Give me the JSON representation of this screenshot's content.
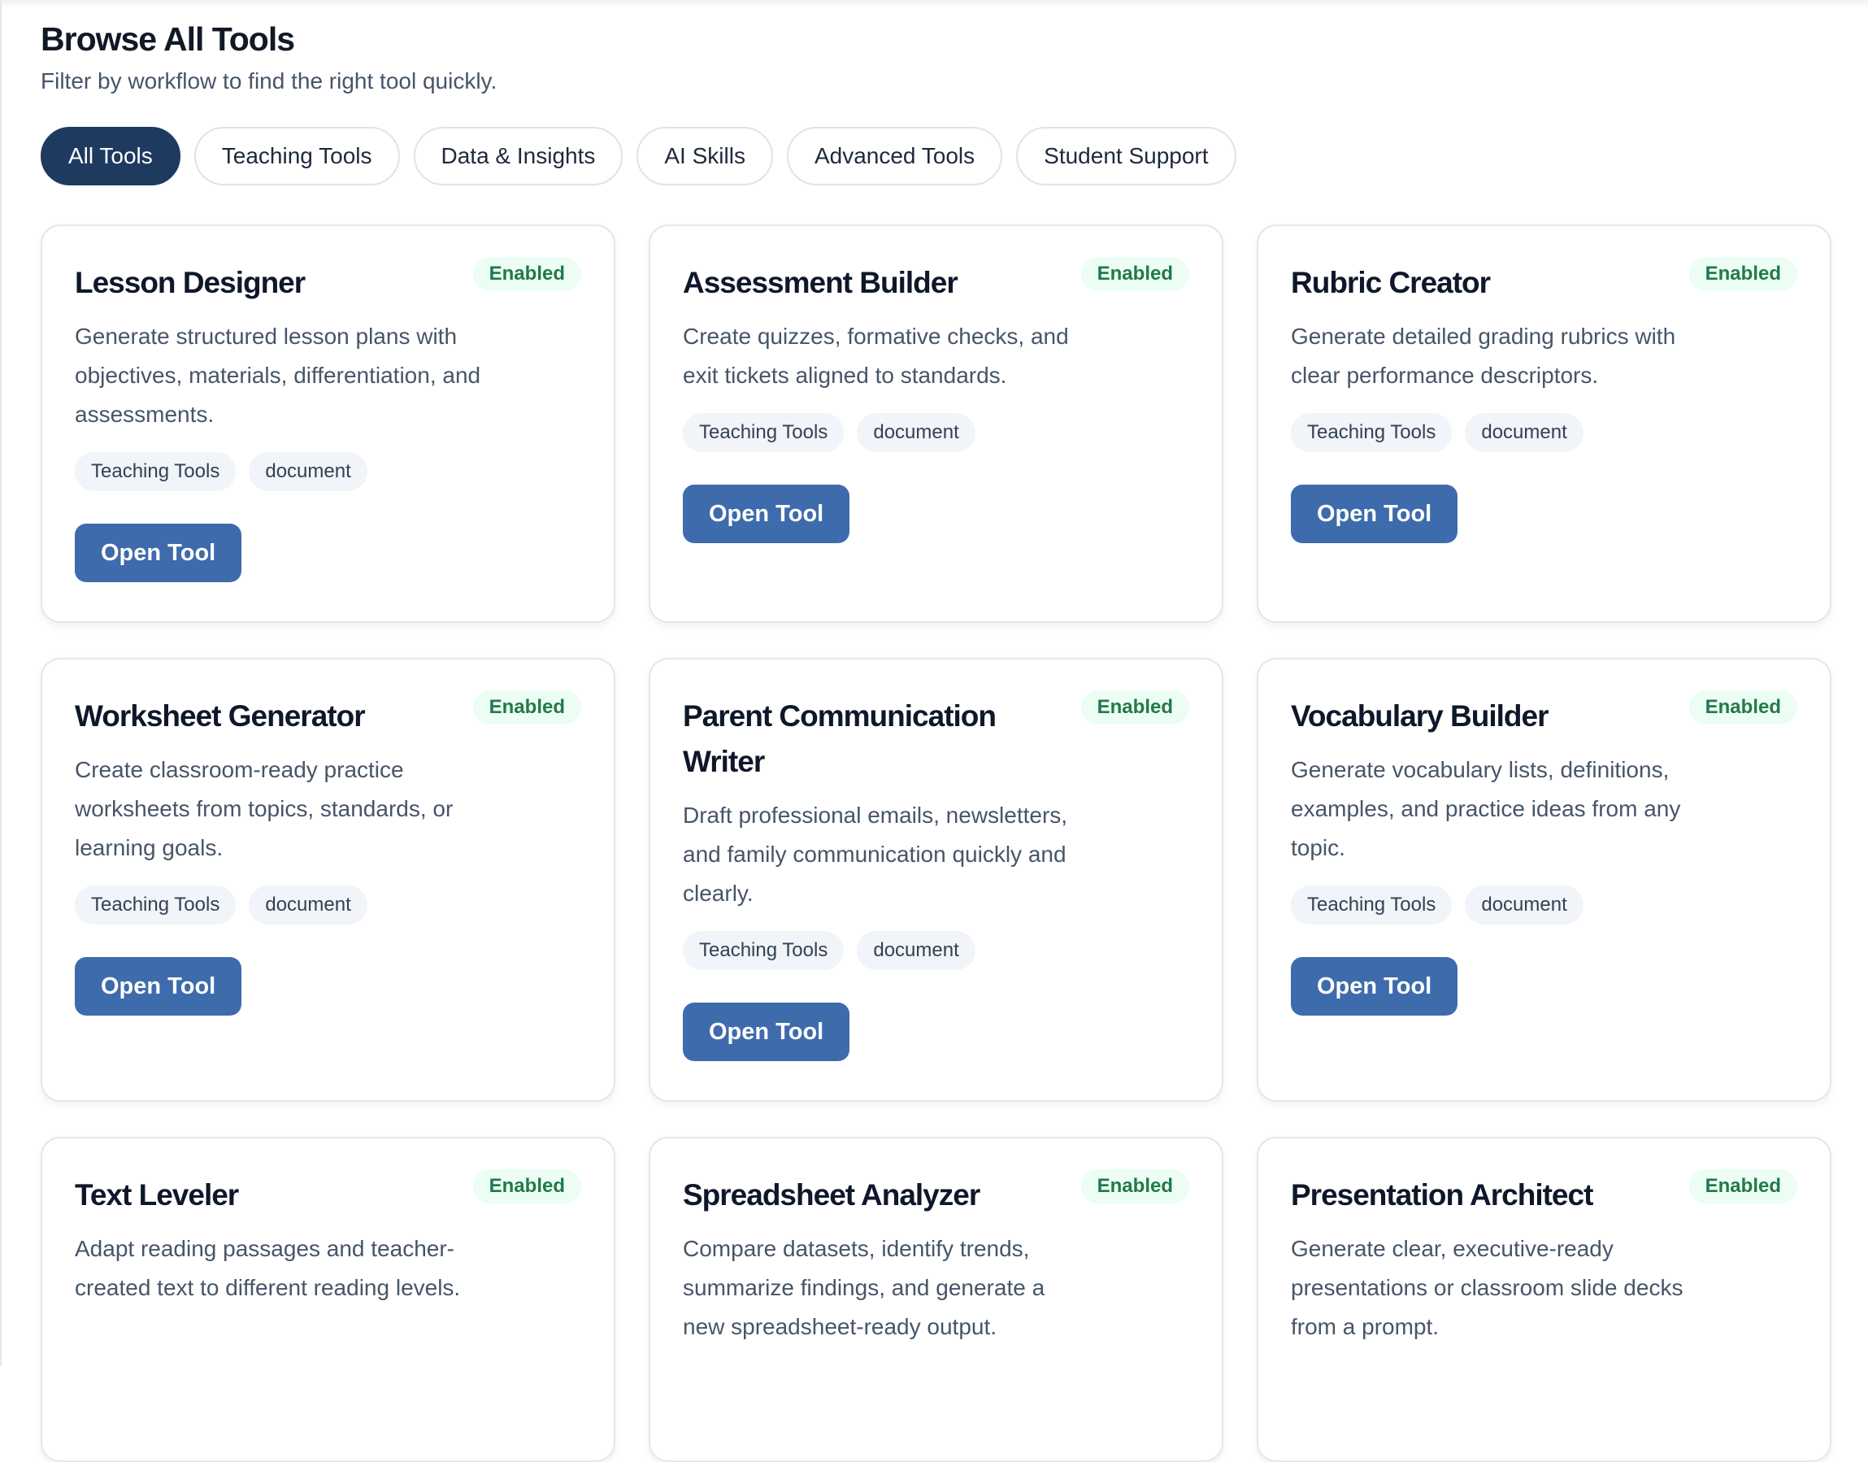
{
  "header": {
    "title": "Browse All Tools",
    "subtitle": "Filter by workflow to find the right tool quickly."
  },
  "filters": [
    {
      "label": "All Tools",
      "active": true
    },
    {
      "label": "Teaching Tools",
      "active": false
    },
    {
      "label": "Data & Insights",
      "active": false
    },
    {
      "label": "AI Skills",
      "active": false
    },
    {
      "label": "Advanced Tools",
      "active": false
    },
    {
      "label": "Student Support",
      "active": false
    }
  ],
  "cards": [
    {
      "title": "Lesson Designer",
      "badge": "Enabled",
      "description": "Generate structured lesson plans with objectives, materials, differentiation, and assessments.",
      "tags": [
        "Teaching Tools",
        "document"
      ],
      "button": "Open Tool"
    },
    {
      "title": "Assessment Builder",
      "badge": "Enabled",
      "description": "Create quizzes, formative checks, and exit tickets aligned to standards.",
      "tags": [
        "Teaching Tools",
        "document"
      ],
      "button": "Open Tool"
    },
    {
      "title": "Rubric Creator",
      "badge": "Enabled",
      "description": "Generate detailed grading rubrics with clear performance descriptors.",
      "tags": [
        "Teaching Tools",
        "document"
      ],
      "button": "Open Tool"
    },
    {
      "title": "Worksheet Generator",
      "badge": "Enabled",
      "description": "Create classroom-ready practice worksheets from topics, standards, or learning goals.",
      "tags": [
        "Teaching Tools",
        "document"
      ],
      "button": "Open Tool"
    },
    {
      "title": "Parent Communication Writer",
      "badge": "Enabled",
      "description": "Draft professional emails, newsletters, and family communication quickly and clearly.",
      "tags": [
        "Teaching Tools",
        "document"
      ],
      "button": "Open Tool"
    },
    {
      "title": "Vocabulary Builder",
      "badge": "Enabled",
      "description": "Generate vocabulary lists, definitions, examples, and practice ideas from any topic.",
      "tags": [
        "Teaching Tools",
        "document"
      ],
      "button": "Open Tool"
    },
    {
      "title": "Text Leveler",
      "badge": "Enabled",
      "description": "Adapt reading passages and teacher-created text to different reading levels.",
      "tags": [],
      "button": ""
    },
    {
      "title": "Spreadsheet Analyzer",
      "badge": "Enabled",
      "description": "Compare datasets, identify trends, summarize findings, and generate a new spreadsheet-ready output.",
      "tags": [],
      "button": ""
    },
    {
      "title": "Presentation Architect",
      "badge": "Enabled",
      "description": "Generate clear, executive-ready presentations or classroom slide decks from a prompt.",
      "tags": [],
      "button": ""
    }
  ],
  "colors": {
    "active_chip": "#1e3a5f",
    "button": "#3e6bab",
    "badge_bg": "#ecfdf3",
    "badge_text": "#217a4a"
  }
}
